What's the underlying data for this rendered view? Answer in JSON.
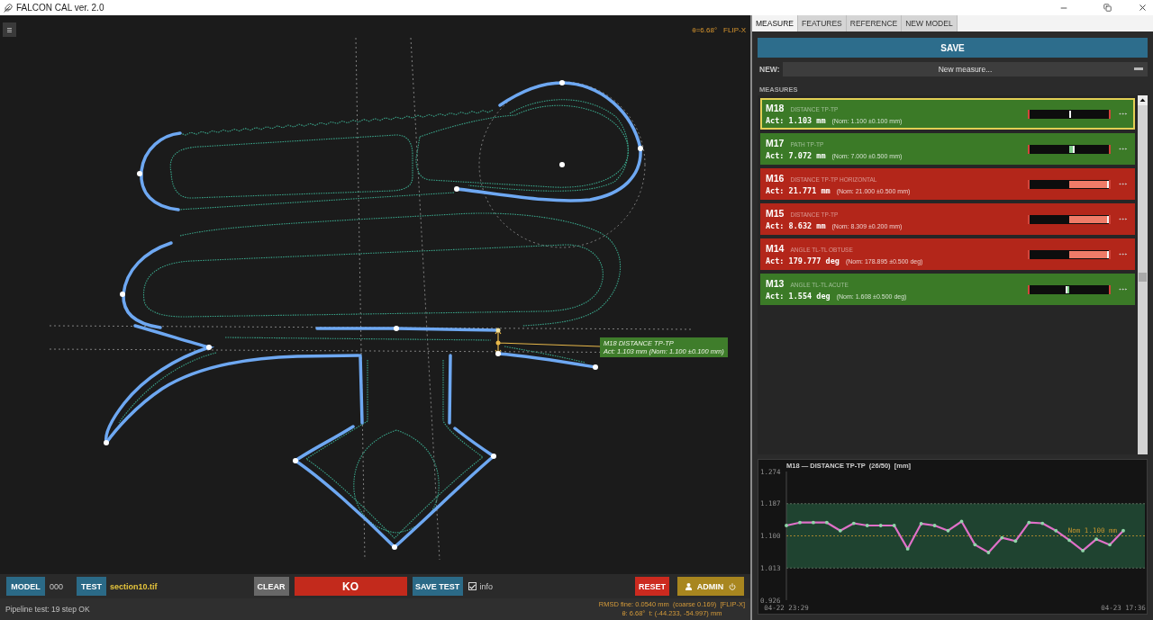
{
  "window": {
    "title": "FALCON CAL ver. 2.0"
  },
  "canvas": {
    "overlay": [
      "θ=6.68°",
      "FLIP-X"
    ],
    "measure_label": {
      "title": "M18 DISTANCE TP-TP",
      "reading": "Act: 1.103 mm (Nom: 1.100 ±0.100 mm)"
    }
  },
  "toolbar": {
    "model": {
      "button": "MODEL",
      "value": "000"
    },
    "test": {
      "button": "TEST",
      "file": "section10.tif"
    },
    "clear": "CLEAR",
    "result": "KO",
    "save_test": "SAVE TEST",
    "info": {
      "label": "info",
      "checked": true
    },
    "reset": "RESET",
    "admin": "ADMIN"
  },
  "status_bar": {
    "message": "Pipeline test: 19 step OK",
    "fit": [
      "RMSD fine: 0.0540 mm  (coarse 0.169)  [FLIP-X]",
      "θ: 6.68°  t: (-44.233, -54.997) mm"
    ]
  },
  "tabs": [
    {
      "label": "MEASURE",
      "selected": true
    },
    {
      "label": "FEATURES",
      "selected": false
    },
    {
      "label": "REFERENCE",
      "selected": false
    },
    {
      "label": "NEW MODEL",
      "selected": false
    }
  ],
  "panel": {
    "save": "SAVE",
    "new_measure": {
      "label": "NEW:",
      "placeholder": "New measure..."
    },
    "measures_heading": "MEASURES",
    "measures": [
      {
        "id": "M18",
        "type": "DISTANCE TP-TP",
        "actual": "Act: 1.103 mm",
        "nominal": "(Nom: 1.100 ±0.100 mm)",
        "in_tolerance": true,
        "selected": true,
        "level": 0.51
      },
      {
        "id": "M17",
        "type": "PATH TP-TP",
        "actual": "Act: 7.072 mm",
        "nominal": "(Nom: 7.000 ±0.500 mm)",
        "in_tolerance": true,
        "selected": false,
        "level": 0.57
      },
      {
        "id": "M16",
        "type": "DISTANCE TP-TP HORIZONTAL",
        "actual": "Act: 21.771 mm",
        "nominal": "(Nom: 21.000 ±0.500 mm)",
        "in_tolerance": false,
        "selected": false,
        "level": 1
      },
      {
        "id": "M15",
        "type": "DISTANCE TP-TP",
        "actual": "Act: 8.632 mm",
        "nominal": "(Nom: 8.309 ±0.200 mm)",
        "in_tolerance": false,
        "selected": false,
        "level": 1
      },
      {
        "id": "M14",
        "type": "ANGLE TL-TL OBTUSE",
        "actual": "Act: 179.777 deg",
        "nominal": "(Nom: 178.895 ±0.500 deg)",
        "in_tolerance": false,
        "selected": false,
        "level": 1
      },
      {
        "id": "M13",
        "type": "ANGLE TL-TL ACUTE",
        "actual": "Act: 1.554 deg",
        "nominal": "(Nom: 1.608 ±0.500 deg)",
        "in_tolerance": true,
        "selected": false,
        "level": 0.45
      }
    ]
  },
  "chart": {
    "chart_data": {
      "type": "line",
      "title": "M18 — DISTANCE TP-TP  (26/50)  [mm]",
      "categories": [
        "04-22 23:29",
        null,
        null,
        null,
        null,
        null,
        null,
        null,
        null,
        null,
        null,
        null,
        null,
        null,
        null,
        null,
        null,
        null,
        null,
        null,
        null,
        null,
        null,
        null,
        null,
        "04-23 17:36"
      ],
      "ylim": [
        0.926,
        1.274
      ],
      "yticks": [
        {
          "value": 1.274,
          "label": "1.274"
        },
        {
          "value": 1.187,
          "label": "1.187"
        },
        {
          "value": 1.1,
          "label": "1.100"
        },
        {
          "value": 1.013,
          "label": "1.013"
        },
        {
          "value": 0.926,
          "label": "0.926"
        }
      ],
      "series": [
        {
          "color": "#e070c8",
          "values": [
            1.128,
            1.136,
            1.136,
            1.136,
            1.114,
            1.134,
            1.128,
            1.128,
            1.128,
            1.065,
            1.133,
            1.128,
            1.114,
            1.139,
            1.076,
            1.055,
            1.095,
            1.086,
            1.136,
            1.134,
            1.114,
            1.088,
            1.06,
            1.091,
            1.076,
            1.114
          ]
        }
      ],
      "bands": [
        {
          "axis": "y",
          "from": 1.013,
          "to": 1.187,
          "color": "#1f4330"
        }
      ],
      "ref_lines": [
        {
          "axis": "y",
          "value": 1.1,
          "label": "Nom 1.100 mm",
          "color": "#c8962e"
        }
      ]
    }
  }
}
